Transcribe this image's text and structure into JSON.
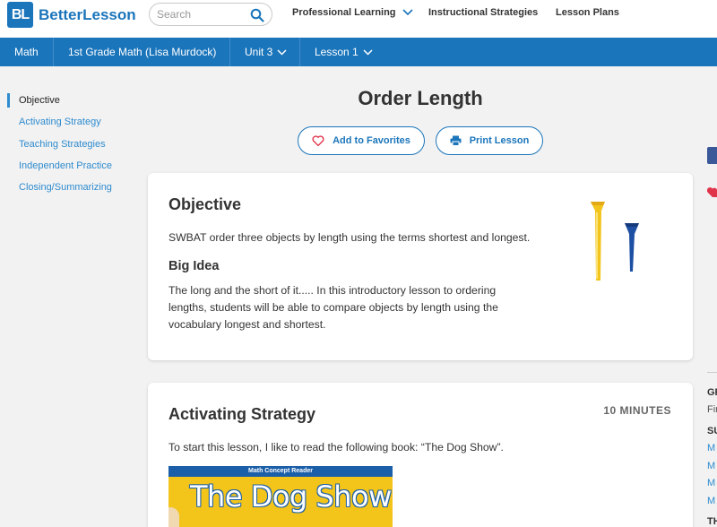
{
  "header": {
    "logo_badge": "BL",
    "logo_text": "BetterLesson",
    "search_placeholder": "Search",
    "nav": [
      {
        "label": "Professional Learning"
      },
      {
        "label": "Instructional Strategies"
      },
      {
        "label": "Lesson Plans"
      }
    ]
  },
  "breadcrumb": {
    "subject": "Math",
    "course": "1st Grade Math (Lisa Murdock)",
    "unit": "Unit 3",
    "lesson": "Lesson 1"
  },
  "sidebar": {
    "items": [
      {
        "label": "Objective"
      },
      {
        "label": "Activating Strategy"
      },
      {
        "label": "Teaching Strategies"
      },
      {
        "label": "Independent Practice"
      },
      {
        "label": "Closing/Summarizing"
      }
    ]
  },
  "lesson": {
    "title": "Order Length",
    "favorites_label": "Add to Favorites",
    "print_label": "Print Lesson"
  },
  "objective_card": {
    "heading": "Objective",
    "objective_text": "SWBAT order three objects by length using the terms shortest and longest.",
    "big_idea_heading": "Big Idea",
    "big_idea_lines": [
      "The long and the short of it..... In this introductory lesson to ordering",
      "lengths, students will be able to compare objects by length using the",
      "vocabulary longest and shortest."
    ]
  },
  "activating_card": {
    "heading": "Activating Strategy",
    "duration": "10 MINUTES",
    "text": "To start this lesson, I like to read the following book:  “The Dog Show”.",
    "book_band": "Math Concept Reader",
    "book_title": "The Dog Show"
  },
  "right_edge": {
    "labels": [
      "GR",
      "Fir",
      "SU",
      "M",
      "M",
      "M",
      "M",
      "TH"
    ]
  },
  "colors": {
    "brand_blue": "#1b75bb",
    "link_blue": "#2e8bcf",
    "page_bg": "#f2f2f2",
    "heart_red": "#e0344a"
  }
}
